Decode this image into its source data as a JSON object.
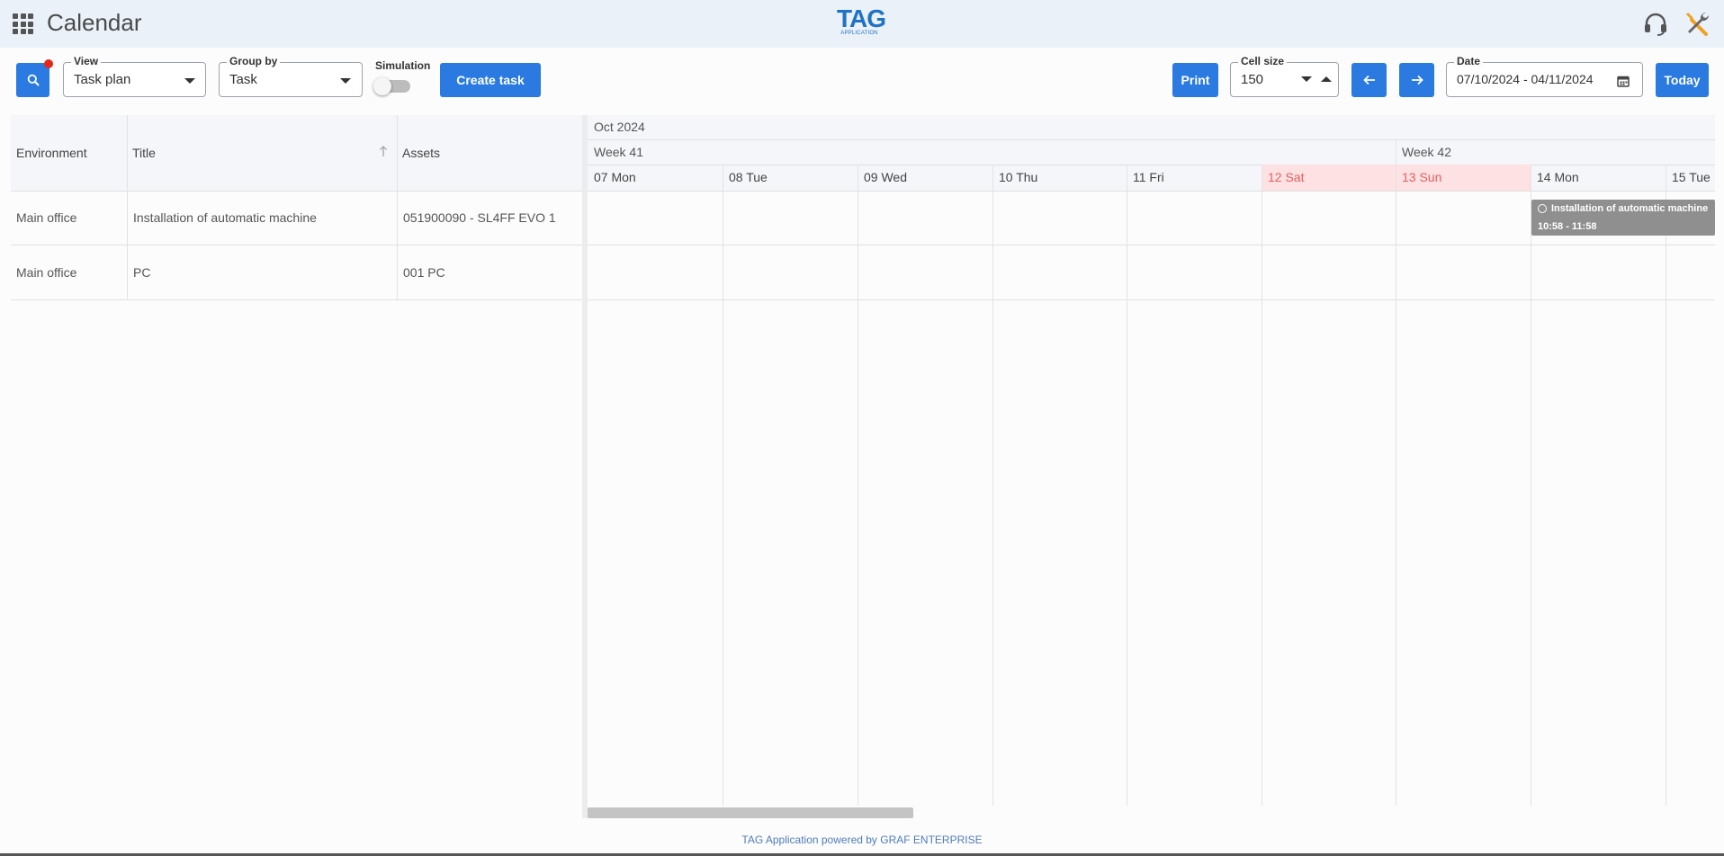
{
  "header": {
    "title": "Calendar",
    "logo_main": "TAG",
    "logo_sub": "APPLICATION"
  },
  "toolbar": {
    "view": {
      "label": "View",
      "value": "Task plan"
    },
    "group_by": {
      "label": "Group by",
      "value": "Task"
    },
    "simulation_label": "Simulation",
    "simulation_on": false,
    "create_task_label": "Create task",
    "print_label": "Print",
    "cell_size": {
      "label": "Cell size",
      "value": "150"
    },
    "date": {
      "label": "Date",
      "value": "07/10/2024 - 04/11/2024"
    },
    "today_label": "Today"
  },
  "table": {
    "columns": [
      "Environment",
      "Title",
      "Assets"
    ],
    "rows": [
      {
        "environment": "Main office",
        "title": "Installation of automatic machine",
        "assets": "051900090 - SL4FF EVO 1"
      },
      {
        "environment": "Main office",
        "title": "PC",
        "assets": "001 PC"
      }
    ]
  },
  "timeline": {
    "month": "Oct 2024",
    "weeks": [
      "Week 41",
      "Week 42"
    ],
    "days": [
      {
        "label": "07 Mon",
        "weekend": false
      },
      {
        "label": "08 Tue",
        "weekend": false
      },
      {
        "label": "09 Wed",
        "weekend": false
      },
      {
        "label": "10 Thu",
        "weekend": false
      },
      {
        "label": "11 Fri",
        "weekend": false
      },
      {
        "label": "12 Sat",
        "weekend": true
      },
      {
        "label": "13 Sun",
        "weekend": true
      },
      {
        "label": "14 Mon",
        "weekend": false
      },
      {
        "label": "15 Tue",
        "weekend": false
      }
    ],
    "event": {
      "title": "Installation of automatic machine",
      "time": "10:58 - 11:58"
    }
  },
  "footer": "TAG Application powered by GRAF ENTERPRISE",
  "colors": {
    "accent": "#2a7ae2",
    "weekend_bg": "#fde1e3",
    "weekend_text": "#e5605f",
    "event_bg": "#8f8f8f"
  }
}
